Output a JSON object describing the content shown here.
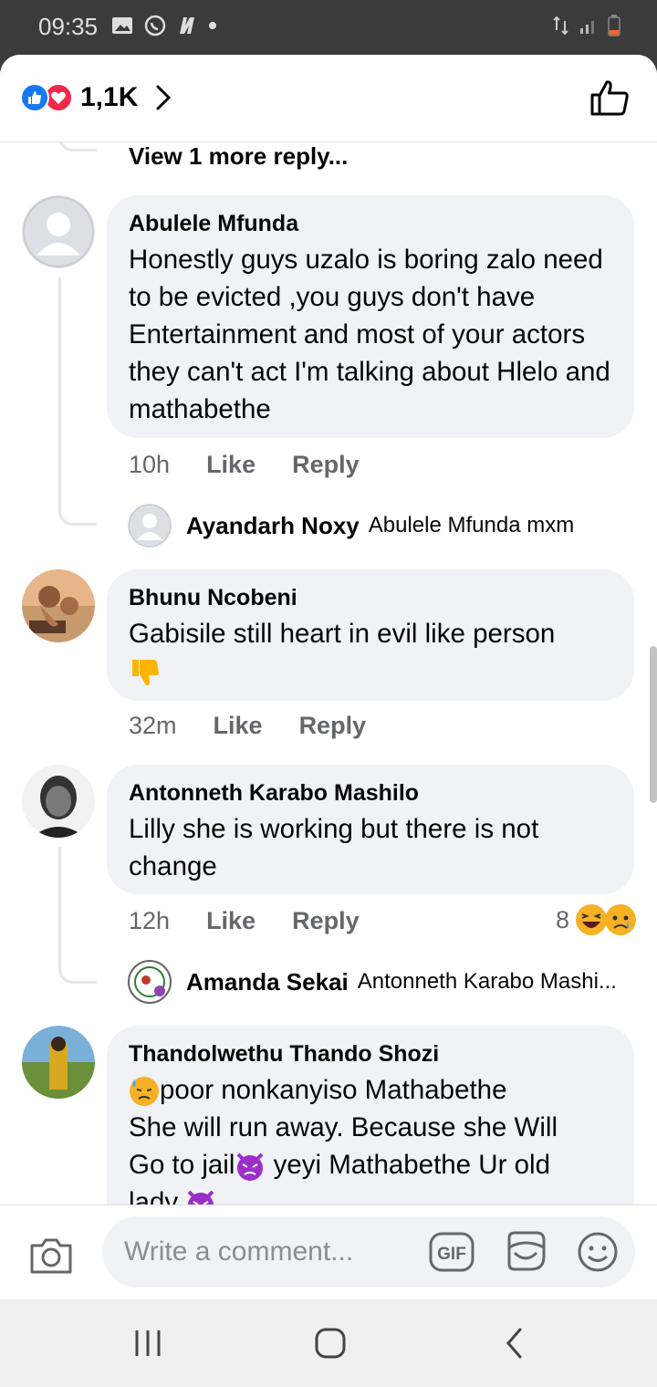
{
  "status_bar": {
    "time": "09:35"
  },
  "header": {
    "reaction_count": "1,1K"
  },
  "feed": {
    "view_more_replies": "View 1 more reply...",
    "comments": [
      {
        "name": "Abulele Mfunda",
        "text": "Honestly guys uzalo is boring zalo need to be evicted ,you guys don't have Entertainment and most of your actors they can't act I'm talking about Hlelo and mathabethe",
        "time": "10h",
        "like": "Like",
        "reply": "Reply",
        "reply_preview": {
          "name": "Ayandarh Noxy",
          "text": "Abulele Mfunda mxm"
        }
      },
      {
        "name": "Bhunu Ncobeni",
        "text": "Gabisile still heart in evil like person",
        "time": "32m",
        "like": "Like",
        "reply": "Reply"
      },
      {
        "name": "Antonneth Karabo Mashilo",
        "text": "Lilly she is working but there is not change",
        "time": "12h",
        "like": "Like",
        "reply": "Reply",
        "reaction_count": "8",
        "reply_preview": {
          "name": "Amanda Sekai",
          "text": "Antonneth Karabo Mashi..."
        }
      },
      {
        "name": "Thandolwethu Thando Shozi",
        "line1": "poor nonkanyiso  Mathabethe",
        "line2": "She will run away. Because she Will",
        "line3a": "Go to jail",
        "line3b": " yeyi Mathabethe Ur old",
        "line4": "lady "
      }
    ]
  },
  "composer": {
    "placeholder": "Write a comment..."
  },
  "colors": {
    "accent": "#1877f2",
    "love": "#f02849",
    "bubble": "#f0f2f5",
    "meta": "#65676b"
  }
}
